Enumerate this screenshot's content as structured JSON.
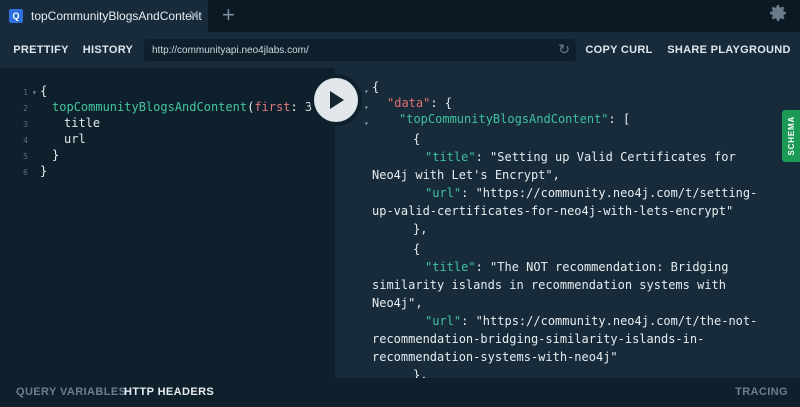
{
  "tab": {
    "badge": "Q",
    "title": "topCommunityBlogsAndContent",
    "close": "✕"
  },
  "tabbar": {
    "add": "+",
    "settings_icon": "gear-icon"
  },
  "toolbar": {
    "prettify": "PRETTIFY",
    "history": "HISTORY",
    "endpoint": "http://communityapi.neo4jlabs.com/",
    "copy_curl": "COPY CURL",
    "share": "SHARE PLAYGROUND"
  },
  "editor": {
    "line_numbers": [
      "1",
      "2",
      "3",
      "4",
      "5",
      "6"
    ],
    "query_open": "{",
    "query_name": "topCommunityBlogsAndContent",
    "arg_name": "first",
    "arg_value": "3",
    "query_close_paren": ") {",
    "fields": [
      "title",
      "url"
    ],
    "close_inner": "}",
    "close_outer": "}"
  },
  "result": {
    "open": "{",
    "data_key": "\"data\"",
    "data_open": ": {",
    "list_key": "\"topCommunityBlogsAndContent\"",
    "list_open": ": [",
    "obj_open": "{",
    "obj_close": "},",
    "title_key": "\"title\"",
    "url_key": "\"url\"",
    "colon": ": ",
    "items": [
      {
        "title_line1": "\"Setting up Valid Certificates for",
        "title_line2": "Neo4j with Let's Encrypt\",",
        "url_line1": "\"https://community.neo4j.com/t/setting-",
        "url_line2": "up-valid-certificates-for-neo4j-with-lets-encrypt\""
      },
      {
        "title_line1": "\"The NOT recommendation: Bridging",
        "title_line2": "similarity islands in recommendation systems with",
        "title_line3": "Neo4j\",",
        "url_line1": "\"https://community.neo4j.com/t/the-not-",
        "url_line2": "recommendation-bridging-similarity-islands-in-",
        "url_line3": "recommendation-systems-with-neo4j\""
      }
    ]
  },
  "schema_label": "SCHEMA",
  "bottom": {
    "query_variables": "QUERY VARIABLES",
    "http_headers": "HTTP HEADERS",
    "tracing": "TRACING"
  },
  "colors": {
    "accent_green": "#1a9a55",
    "key_green": "#3fc19d",
    "key_red": "#e36f6f",
    "background": "#0f202d"
  }
}
